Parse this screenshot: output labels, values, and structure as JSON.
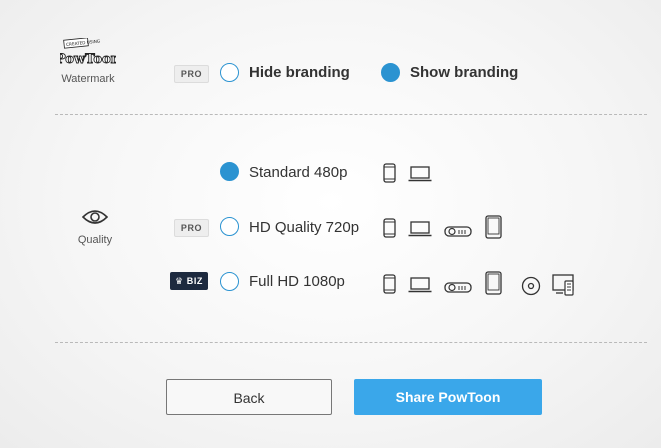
{
  "watermark": {
    "label": "Watermark",
    "logo_small_text": "CREATED USING",
    "logo_text": "PowToon",
    "badge": "PRO",
    "options": [
      {
        "label": "Hide branding",
        "selected": false
      },
      {
        "label": "Show branding",
        "selected": true
      }
    ]
  },
  "quality": {
    "label": "Quality",
    "options": [
      {
        "label": "Standard 480p",
        "selected": true,
        "badge": "",
        "devices": [
          "phone-icon",
          "laptop-icon"
        ]
      },
      {
        "label": "HD Quality 720p",
        "selected": false,
        "badge": "PRO",
        "devices": [
          "phone-icon",
          "laptop-icon",
          "projector-icon",
          "tablet-icon"
        ]
      },
      {
        "label": "Full HD 1080p",
        "selected": false,
        "badge": "BIZ",
        "devices": [
          "phone-icon",
          "laptop-icon",
          "projector-icon",
          "tablet-icon",
          "disc-icon",
          "screen-icon"
        ]
      }
    ]
  },
  "buttons": {
    "back": "Back",
    "share": "Share PowToon"
  },
  "colors": {
    "accent": "#2b93d1",
    "share_button": "#3aa7ea",
    "biz_badge": "#1d2a3f"
  }
}
